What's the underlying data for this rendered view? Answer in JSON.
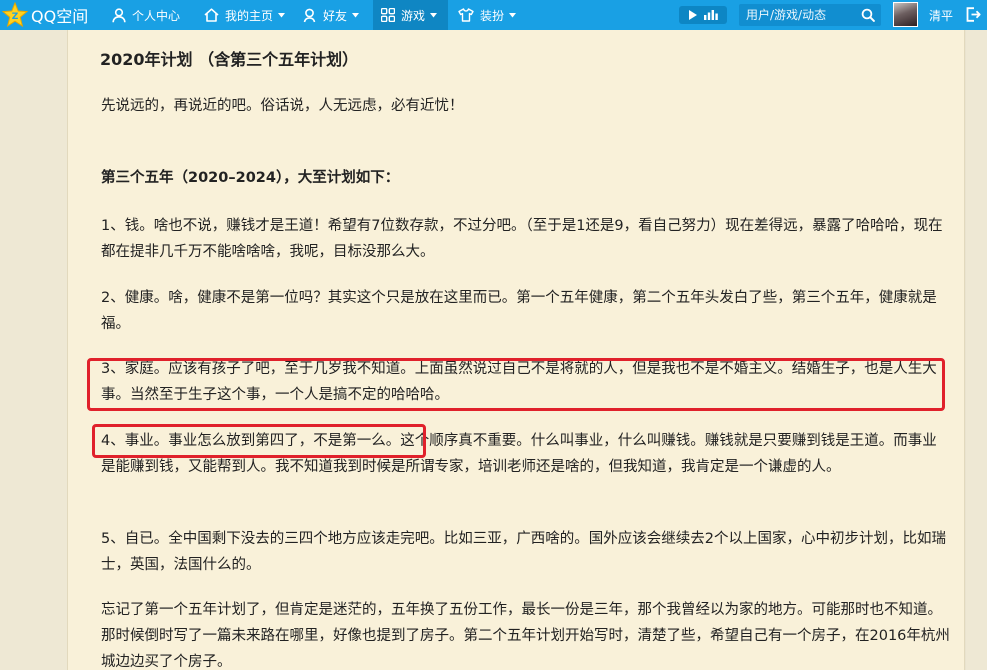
{
  "header": {
    "logo_text": "QQ空间",
    "nav": [
      {
        "label": "个人中心",
        "icon": "user-icon"
      },
      {
        "label": "我的主页",
        "icon": "home-icon"
      },
      {
        "label": "好友",
        "icon": "friends-icon"
      },
      {
        "label": "游戏",
        "icon": "games-grid-icon"
      },
      {
        "label": "装扮",
        "icon": "tshirt-icon"
      }
    ],
    "search_placeholder": "用户/游戏/动态",
    "username": "清平",
    "colors": {
      "bar": "#19a0e4",
      "active_tab": "#0f86c3"
    }
  },
  "article": {
    "title": "2020年计划 （含第三个五年计划）",
    "paragraphs": [
      "先说远的，再说近的吧。俗话说，人无远虑，必有近忧！",
      "第三个五年（2020–2024），大至计划如下：",
      "1、钱。啥也不说，赚钱才是王道！希望有7位数存款，不过分吧。（至于是1还是9，看自己努力）现在差得远，暴露了哈哈哈，现在都在提非几千万不能啥啥啥，我呢，目标没那么大。",
      "2、健康。啥，健康不是第一位吗？其实这个只是放在这里而已。第一个五年健康，第二个五年头发白了些，第三个五年，健康就是福。",
      "3、家庭。应该有孩子了吧，至于几岁我不知道。上面虽然说过自己不是将就的人，但是我也不是不婚主义。结婚生子，也是人生大事。当然至于生子这个事，一个人是搞不定的哈哈哈。",
      "4、事业。事业怎么放到第四了，不是第一么。这个顺序真不重要。什么叫事业，什么叫赚钱。赚钱就是只要赚到钱是王道。而事业是能赚到钱，又能帮到人。我不知道我到时候是所谓专家，培训老师还是啥的，但我知道，我肯定是一个谦虚的人。",
      "5、自已。全中国剩下没去的三四个地方应该走完吧。比如三亚，广西啥的。国外应该会继续去2个以上国家，心中初步计划，比如瑞士，英国，法国什么的。",
      "忘记了第一个五年计划了，但肯定是迷茫的，五年换了五份工作，最长一份是三年，那个我曾经以为家的地方。可能那时也不知道。那时候倒时写了一篇未来路在哪里，好像也提到了房子。第二个五年计划开始写时，清楚了些，希望自己有一个房子，在2016年杭州城边边买了个房子。"
    ],
    "highlight_color": "#e0212b"
  }
}
